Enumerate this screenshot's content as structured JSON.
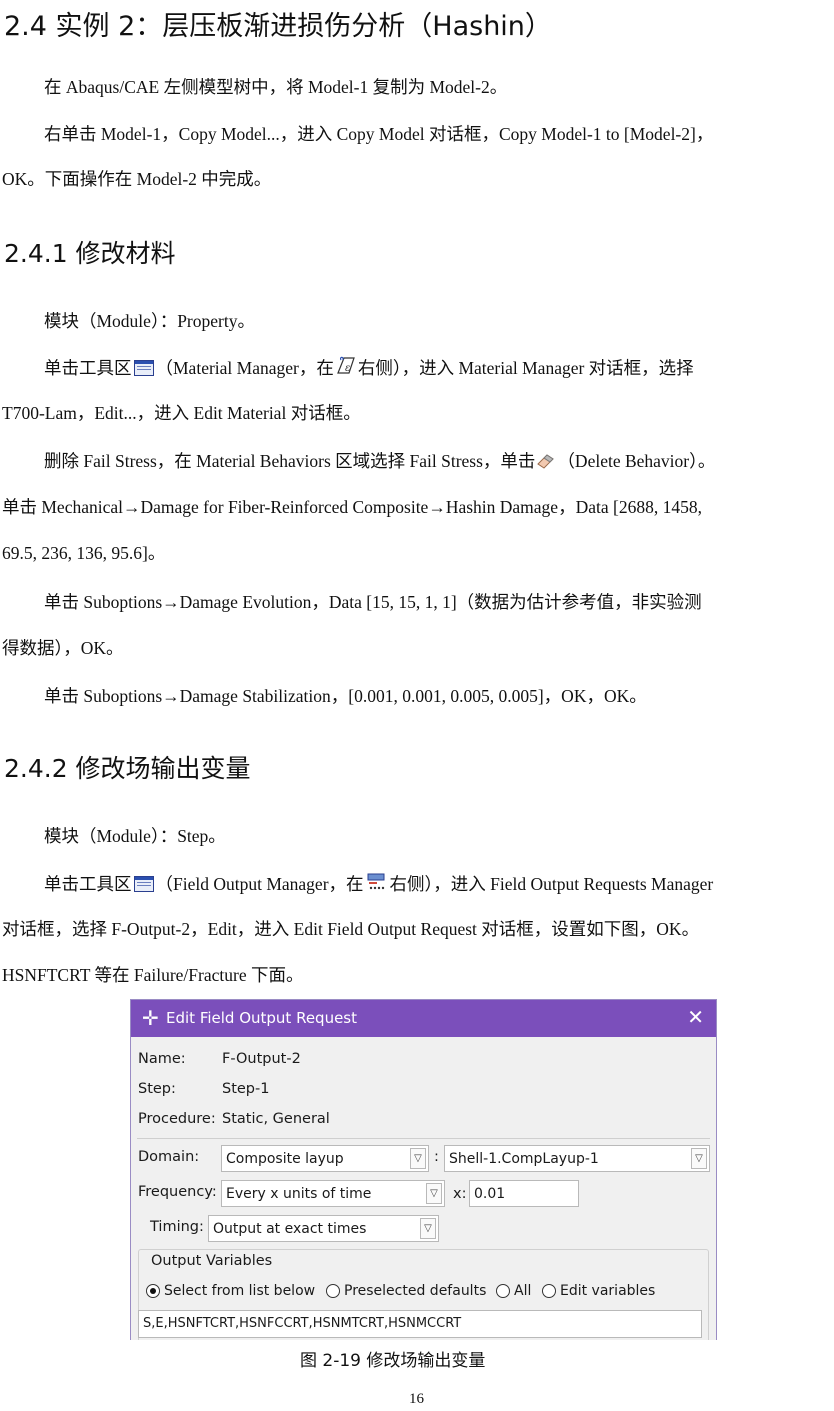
{
  "heading_2_4": "2.4 实例 2：层压板渐进损伤分析（Hashin）",
  "intro_p1": "在 Abaqus/CAE 左侧模型树中，将 Model-1 复制为 Model-2。",
  "intro_p2_line1": "右单击 Model-1，Copy Model...，进入 Copy Model 对话框，Copy Model-1 to [Model-2]，",
  "intro_p2_line2": "OK。下面操作在 Model-2 中完成。",
  "heading_2_4_1": "2.4.1 修改材料",
  "s1_module": "模块（Module）：Property。",
  "s1_p2_a": "单击工具区",
  "s1_p2_b": "（Material Manager，在",
  "s1_p2_c": "右侧），进入 Material Manager 对话框，选择",
  "s1_p2_line2": "T700-Lam，Edit...，进入 Edit Material 对话框。",
  "s1_p3_a": "删除 Fail Stress，在 Material Behaviors 区域选择 Fail Stress，单击",
  "s1_p3_b": "（Delete Behavior）。",
  "s1_p4_line1": "单击 Mechanical→Damage for Fiber-Reinforced Composite→Hashin Damage，Data [2688, 1458,",
  "s1_p4_line2": "69.5, 236, 136, 95.6]。",
  "s1_p5_line1": "单击 Suboptions→Damage Evolution，Data [15, 15, 1, 1]（数据为估计参考值，非实验测",
  "s1_p5_line2": "得数据），OK。",
  "s1_p6": "单击 Suboptions→Damage Stabilization，[0.001, 0.001, 0.005, 0.005]，OK，OK。",
  "heading_2_4_2": "2.4.2 修改场输出变量",
  "s2_module": "模块（Module）：Step。",
  "s2_p2_a": "单击工具区",
  "s2_p2_b": "（Field Output Manager，在",
  "s2_p2_c": "右侧），进入 Field Output Requests Manager",
  "s2_p2_line2": "对话框，选择 F-Output-2，Edit，进入 Edit Field Output Request 对话框，设置如下图，OK。",
  "s2_p3": "HSNFTCRT 等在 Failure/Fracture 下面。",
  "dialog": {
    "title": "Edit Field Output Request",
    "name_label": "Name:",
    "name_value": "F-Output-2",
    "step_label": "Step:",
    "step_value": "Step-1",
    "procedure_label": "Procedure:",
    "procedure_value": "Static, General",
    "domain_label": "Domain:",
    "domain_value": "Composite layup",
    "domain_sep": ":",
    "domain_target": "Shell-1.CompLayup-1",
    "frequency_label": "Frequency:",
    "frequency_value": "Every x units of time",
    "x_label": "x:",
    "x_value": "0.01",
    "timing_label": "Timing:",
    "timing_value": "Output at exact times",
    "output_variables_label": "Output Variables",
    "radio_options": [
      "Select from list below",
      "Preselected defaults",
      "All",
      "Edit variables"
    ],
    "radio_selected": "Select from list below",
    "variables_value": "S,E,HSNFTCRT,HSNFCCRT,HSNMTCRT,HSNMCCRT"
  },
  "figure_caption": "图 2-19  修改场输出变量",
  "page_number": "16",
  "icons": {
    "manager_icon": "table-manager-icon",
    "material_icon": "material-create-icon",
    "field_output_icon": "field-output-create-icon",
    "delete_icon": "eraser-icon",
    "close_icon": "close-icon",
    "move_icon": "move-icon"
  },
  "colors": {
    "dialog_title_bar": "#7b4fbb"
  }
}
